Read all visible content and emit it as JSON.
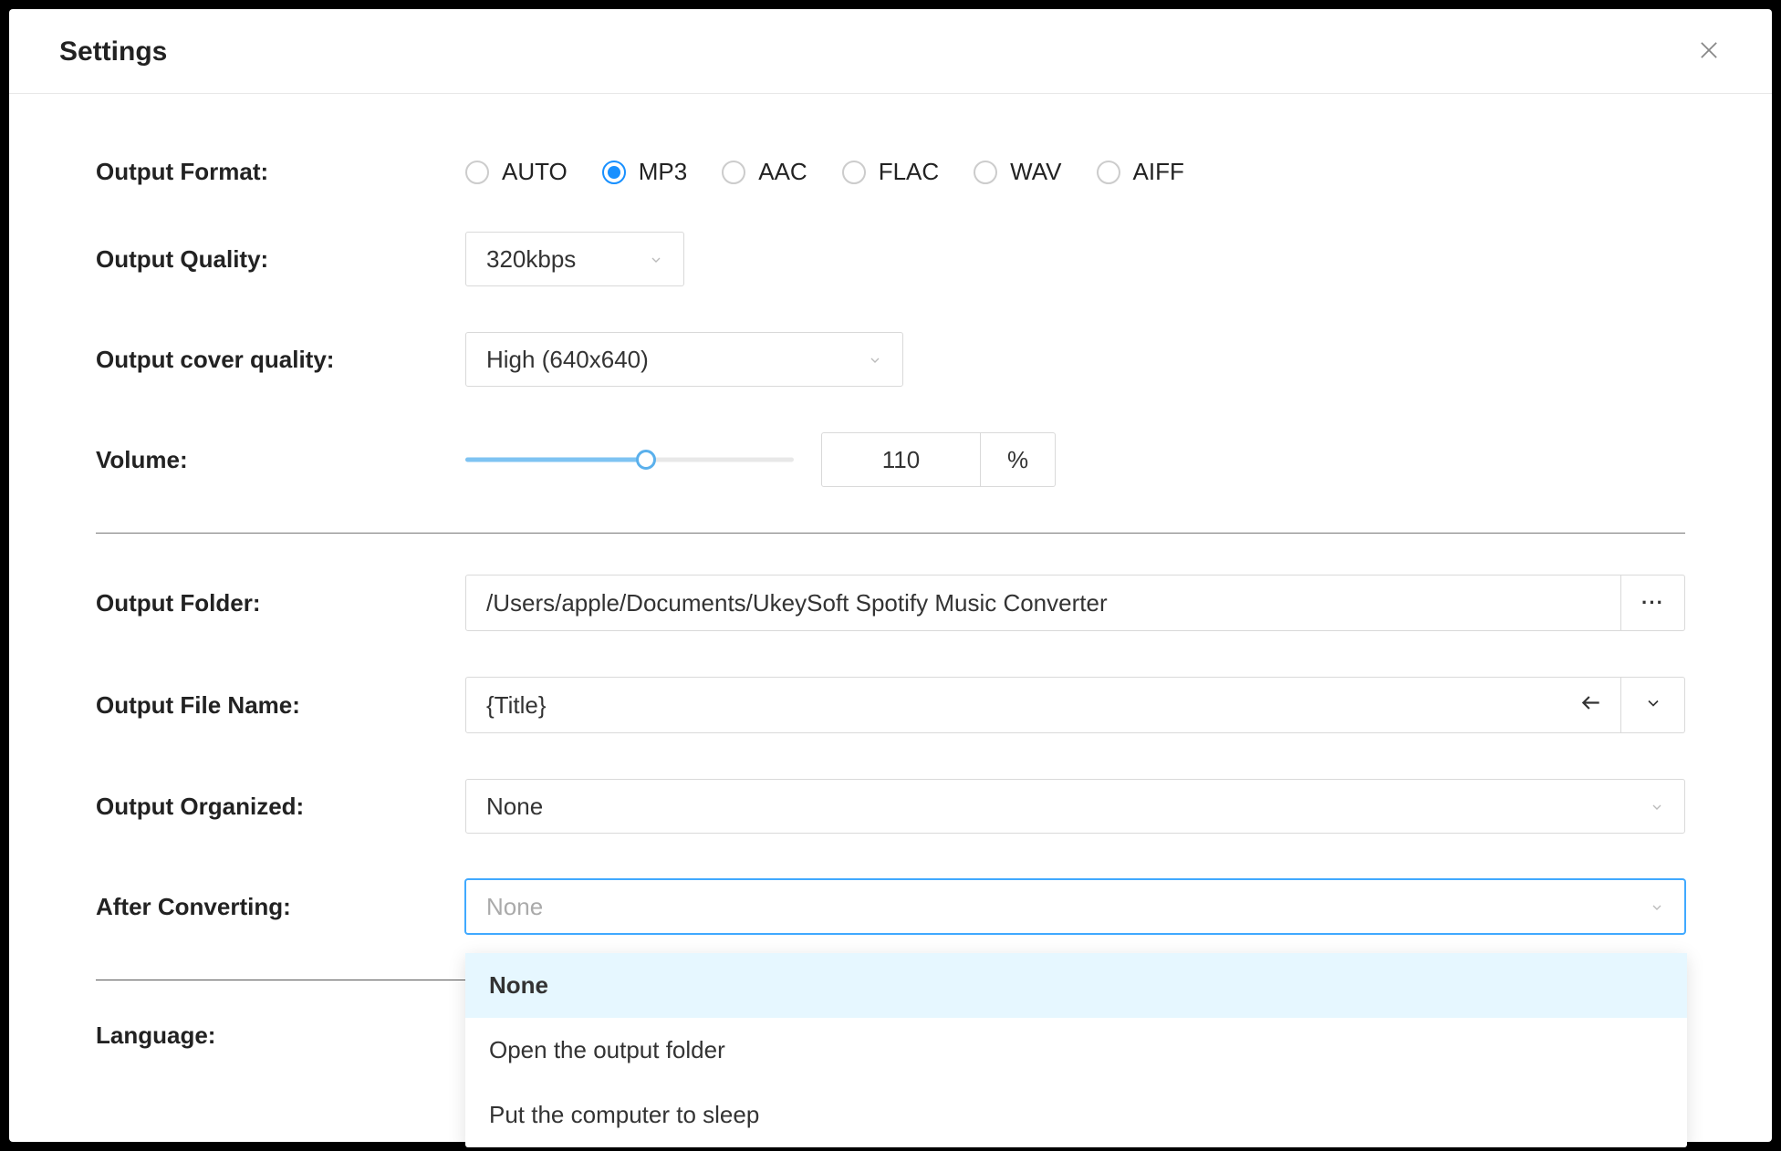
{
  "header": {
    "title": "Settings"
  },
  "output_format": {
    "label": "Output Format:",
    "options": [
      "AUTO",
      "MP3",
      "AAC",
      "FLAC",
      "WAV",
      "AIFF"
    ],
    "selected": "MP3"
  },
  "output_quality": {
    "label": "Output Quality:",
    "value": "320kbps"
  },
  "output_cover_quality": {
    "label": "Output cover quality:",
    "value": "High (640x640)"
  },
  "volume": {
    "label": "Volume:",
    "value": "110",
    "unit": "%",
    "slider_percent": 55
  },
  "output_folder": {
    "label": "Output Folder:",
    "value": "/Users/apple/Documents/UkeySoft Spotify Music Converter"
  },
  "output_file_name": {
    "label": "Output File Name:",
    "value": "{Title}"
  },
  "output_organized": {
    "label": "Output Organized:",
    "value": "None"
  },
  "after_converting": {
    "label": "After Converting:",
    "placeholder": "None",
    "options": [
      "None",
      "Open the output folder",
      "Put the computer to sleep"
    ],
    "selected": "None"
  },
  "language": {
    "label": "Language:"
  }
}
